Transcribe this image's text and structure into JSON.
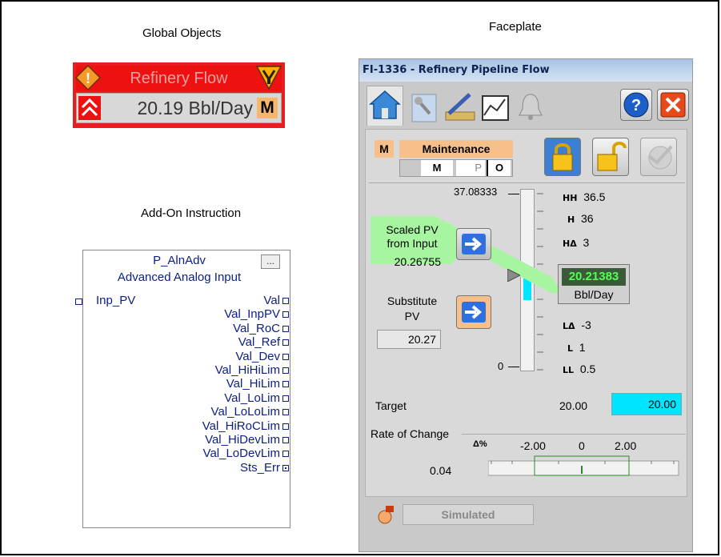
{
  "headers": {
    "global_objects": "Global Objects",
    "faceplate": "Faceplate",
    "add_on_instruction": "Add-On Instruction"
  },
  "global_object": {
    "title": "Refinery Flow",
    "value": "20.19 Bbl/Day",
    "mode": "M",
    "colors": {
      "alarm": "#ee1111",
      "mode": "#f7b768"
    }
  },
  "aoi": {
    "name": "P_AlnAdv",
    "description": "Advanced Analog Input",
    "dots_label": "...",
    "input": "Inp_PV",
    "outputs": [
      "Val",
      "Val_InpPV",
      "Val_RoC",
      "Val_Ref",
      "Val_Dev",
      "Val_HiHiLim",
      "Val_HiLim",
      "Val_LoLim",
      "Val_LoLoLim",
      "Val_HiRoCLim",
      "Val_HiDevLim",
      "Val_LoDevLim",
      "Sts_Err"
    ]
  },
  "faceplate": {
    "title": "FI-1336 - Refinery Pipeline Flow",
    "help_label": "?",
    "mode_box": "M",
    "mode_label": "Maintenance",
    "mode_cells": [
      "M",
      "P",
      "O"
    ],
    "scale_max": "37.08333",
    "scale_min": "0",
    "scaled_pv_label": "Scaled PV from Input",
    "scaled_pv_value": "20.26755",
    "substitute_pv_label": "Substitute PV",
    "substitute_pv_value": "20.27",
    "pv_display": "20.21383",
    "pv_units": "Bbl/Day",
    "limits": [
      {
        "tag": "HH",
        "value": "36.5"
      },
      {
        "tag": "H",
        "value": "36"
      },
      {
        "tag": "HΔ",
        "value": "3"
      },
      {
        "tag": "LΔ",
        "value": "-3"
      },
      {
        "tag": "L",
        "value": "1"
      },
      {
        "tag": "LL",
        "value": "0.5"
      }
    ],
    "target_label": "Target",
    "target_value": "20.00",
    "target_entry": "20.00",
    "roc_label": "Rate of Change",
    "roc_ticks": [
      "-2.00",
      "0",
      "2.00"
    ],
    "roc_value": "0.04",
    "roc_symbol": "Δ%",
    "simulated_label": "Simulated",
    "colors": {
      "accent": "#00e5ff",
      "mode": "#f7c08a",
      "pv_bg": "#3a5a3a",
      "pv_text": "#54ff54"
    }
  }
}
